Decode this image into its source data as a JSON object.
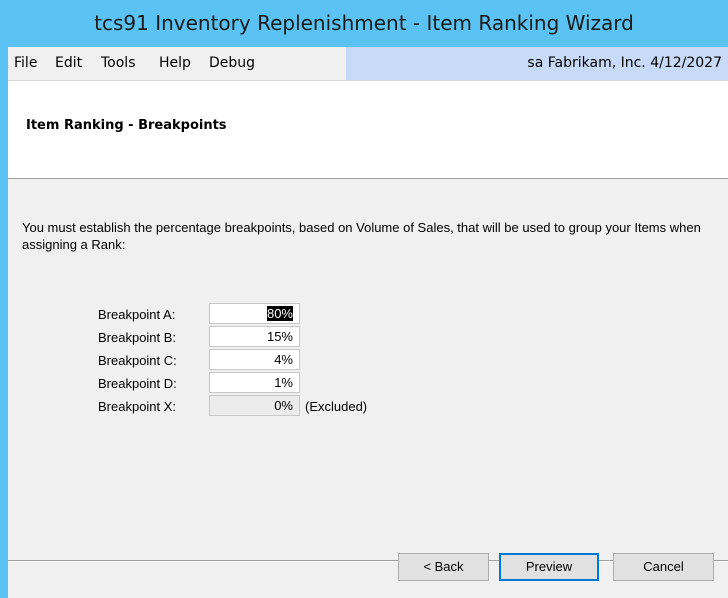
{
  "window": {
    "title": "tcs91 Inventory Replenishment - Item Ranking Wizard"
  },
  "menubar": {
    "items": [
      "File",
      "Edit",
      "Tools",
      "Help",
      "Debug"
    ],
    "status": "sa  Fabrikam, Inc.  4/12/2027"
  },
  "header": {
    "title": "Item Ranking - Breakpoints"
  },
  "body": {
    "instructions": "You must establish the percentage breakpoints, based on Volume of Sales, that will be used to group your Items when assigning a Rank:"
  },
  "breakpoints": [
    {
      "label": "Breakpoint A:",
      "value": "80%",
      "enabled": true,
      "selected": true
    },
    {
      "label": "Breakpoint B:",
      "value": "15%",
      "enabled": true
    },
    {
      "label": "Breakpoint C:",
      "value": "4%",
      "enabled": true
    },
    {
      "label": "Breakpoint D:",
      "value": "1%",
      "enabled": true
    },
    {
      "label": "Breakpoint X:",
      "value": "0%",
      "enabled": false,
      "note": "(Excluded)"
    }
  ],
  "buttons": {
    "back": "< Back",
    "preview": "Preview",
    "cancel": "Cancel"
  }
}
